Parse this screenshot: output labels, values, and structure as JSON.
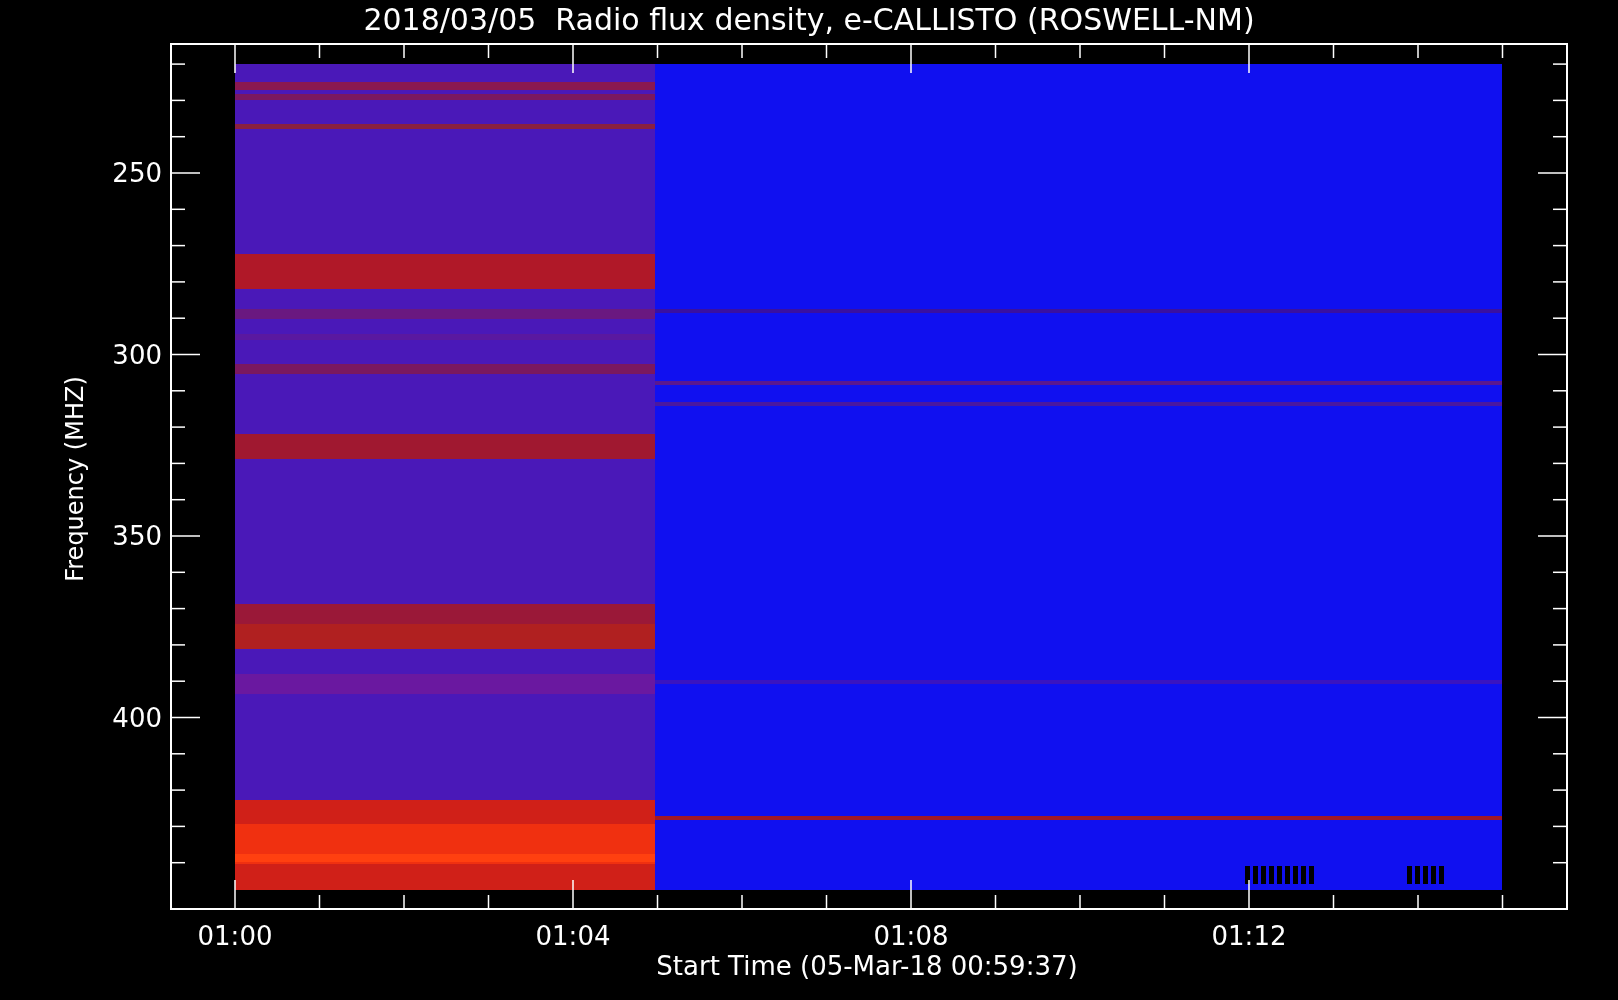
{
  "title": "2018/03/05  Radio flux density, e-CALLISTO (ROSWELL-NM)",
  "y_axis": {
    "label": "Frequency (MHZ)",
    "ticks": [
      "250",
      "300",
      "350",
      "400"
    ]
  },
  "x_axis": {
    "label": "Start Time (05-Mar-18 00:59:37)",
    "ticks": [
      "01:00",
      "01:04",
      "01:08",
      "01:12"
    ]
  }
}
